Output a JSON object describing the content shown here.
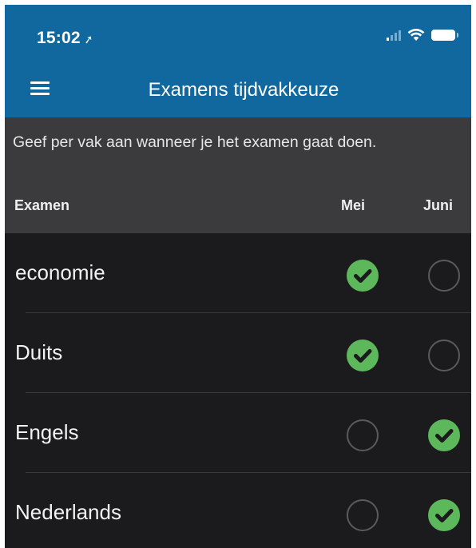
{
  "status_bar": {
    "time": "15:02",
    "location_glyph": "➚"
  },
  "nav": {
    "title": "Examens tijdvakkeuze",
    "menu_icon": "hamburger-menu-icon"
  },
  "instruction": "Geef per vak aan wanneer je het examen gaat doen.",
  "columns": {
    "exam": "Examen",
    "mei": "Mei",
    "juni": "Juni"
  },
  "exams": [
    {
      "name": "economie",
      "choice": "Mei"
    },
    {
      "name": "Duits",
      "choice": "Mei"
    },
    {
      "name": "Engels",
      "choice": "Juni"
    },
    {
      "name": "Nederlands",
      "choice": "Juni"
    }
  ],
  "colors": {
    "nav_bar": "#10689f",
    "header_bg": "#3b3b3d",
    "list_bg": "#1b1b1d",
    "check_green": "#5db85c"
  }
}
